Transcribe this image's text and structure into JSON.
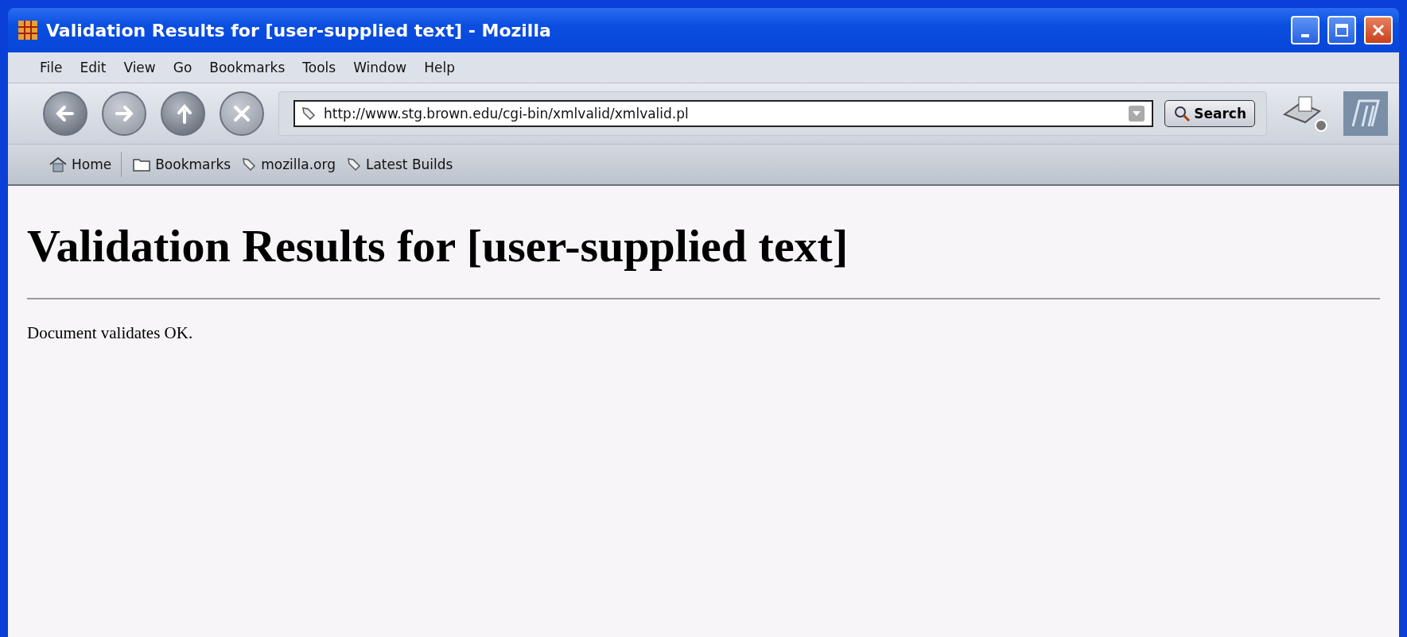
{
  "window": {
    "title": "Validation Results for [user-supplied text] - Mozilla"
  },
  "menu": [
    "File",
    "Edit",
    "View",
    "Go",
    "Bookmarks",
    "Tools",
    "Window",
    "Help"
  ],
  "navigation": {
    "url": "http://www.stg.brown.edu/cgi-bin/xmlvalid/xmlvalid.pl",
    "search_button": "Search",
    "buttons": [
      {
        "kind": "back",
        "disabled": false
      },
      {
        "kind": "forward",
        "disabled": true
      },
      {
        "kind": "reload",
        "disabled": false
      },
      {
        "kind": "stop",
        "disabled": true
      }
    ]
  },
  "bookmarks_bar": [
    {
      "kind": "home",
      "label": "Home"
    },
    {
      "kind": "folder",
      "label": "Bookmarks"
    },
    {
      "kind": "link",
      "label": "mozilla.org"
    },
    {
      "kind": "link",
      "label": "Latest Builds"
    }
  ],
  "page": {
    "heading": "Validation Results for [user-supplied text]",
    "message": "Document validates OK."
  }
}
